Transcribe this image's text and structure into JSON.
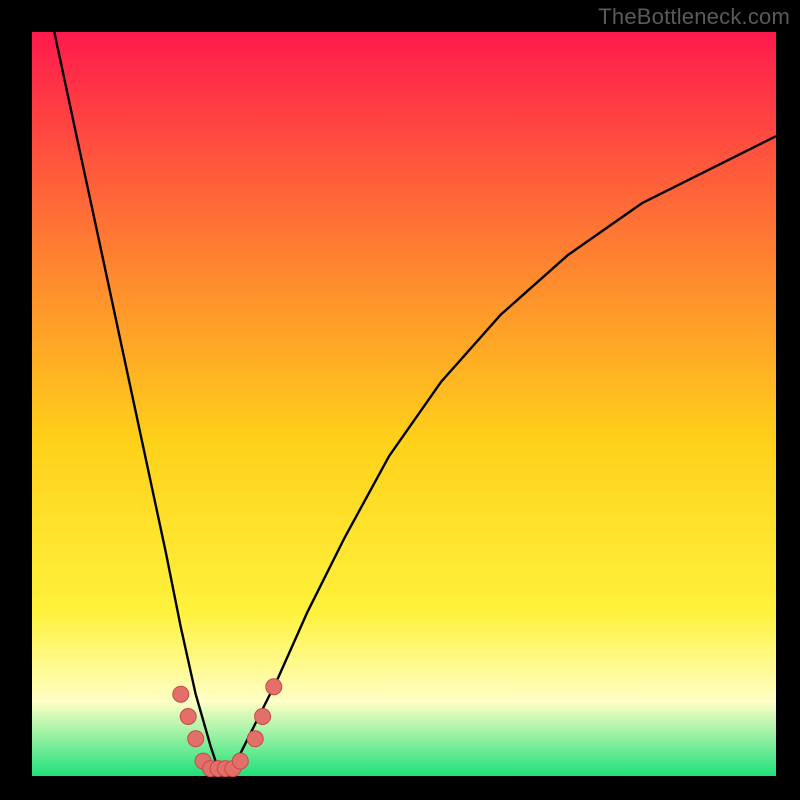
{
  "attribution": "TheBottleneck.com",
  "colors": {
    "frame": "#000000",
    "gradient_top": "#ff1a4d",
    "gradient_mid1": "#ff7a33",
    "gradient_mid2": "#ffd11a",
    "gradient_mid3": "#fff23d",
    "gradient_pale": "#ffffc6",
    "gradient_bottom": "#1ee07a",
    "curve": "#000000",
    "marker_fill": "#e36f6a",
    "marker_stroke": "#c84a44"
  },
  "chart_data": {
    "type": "line",
    "title": "",
    "xlabel": "",
    "ylabel": "",
    "xlim": [
      0,
      100
    ],
    "ylim": [
      0,
      100
    ],
    "series": [
      {
        "name": "bottleneck-curve",
        "note": "V-shaped curve, minimum near x≈25; values read approximately from vertical position (0 = bottom/green, 100 = top/red).",
        "x": [
          3,
          6,
          9,
          12,
          15,
          18,
          20,
          22,
          24,
          25,
          26,
          28,
          30,
          33,
          37,
          42,
          48,
          55,
          63,
          72,
          82,
          92,
          100
        ],
        "y": [
          100,
          86,
          72,
          58,
          44,
          30,
          20,
          11,
          4,
          1,
          1,
          3,
          7,
          13,
          22,
          32,
          43,
          53,
          62,
          70,
          77,
          82,
          86
        ]
      }
    ],
    "markers": {
      "name": "highlighted-points",
      "note": "Salmon circular markers clustered around the curve minimum.",
      "points": [
        {
          "x": 20,
          "y": 11
        },
        {
          "x": 21,
          "y": 8
        },
        {
          "x": 22,
          "y": 5
        },
        {
          "x": 23,
          "y": 2
        },
        {
          "x": 24,
          "y": 1
        },
        {
          "x": 25,
          "y": 1
        },
        {
          "x": 26,
          "y": 1
        },
        {
          "x": 27,
          "y": 1
        },
        {
          "x": 28,
          "y": 2
        },
        {
          "x": 30,
          "y": 5
        },
        {
          "x": 31,
          "y": 8
        },
        {
          "x": 32.5,
          "y": 12
        }
      ]
    },
    "gradient_meaning": "vertical fill encodes severity: red=high bottleneck, green=no bottleneck"
  }
}
